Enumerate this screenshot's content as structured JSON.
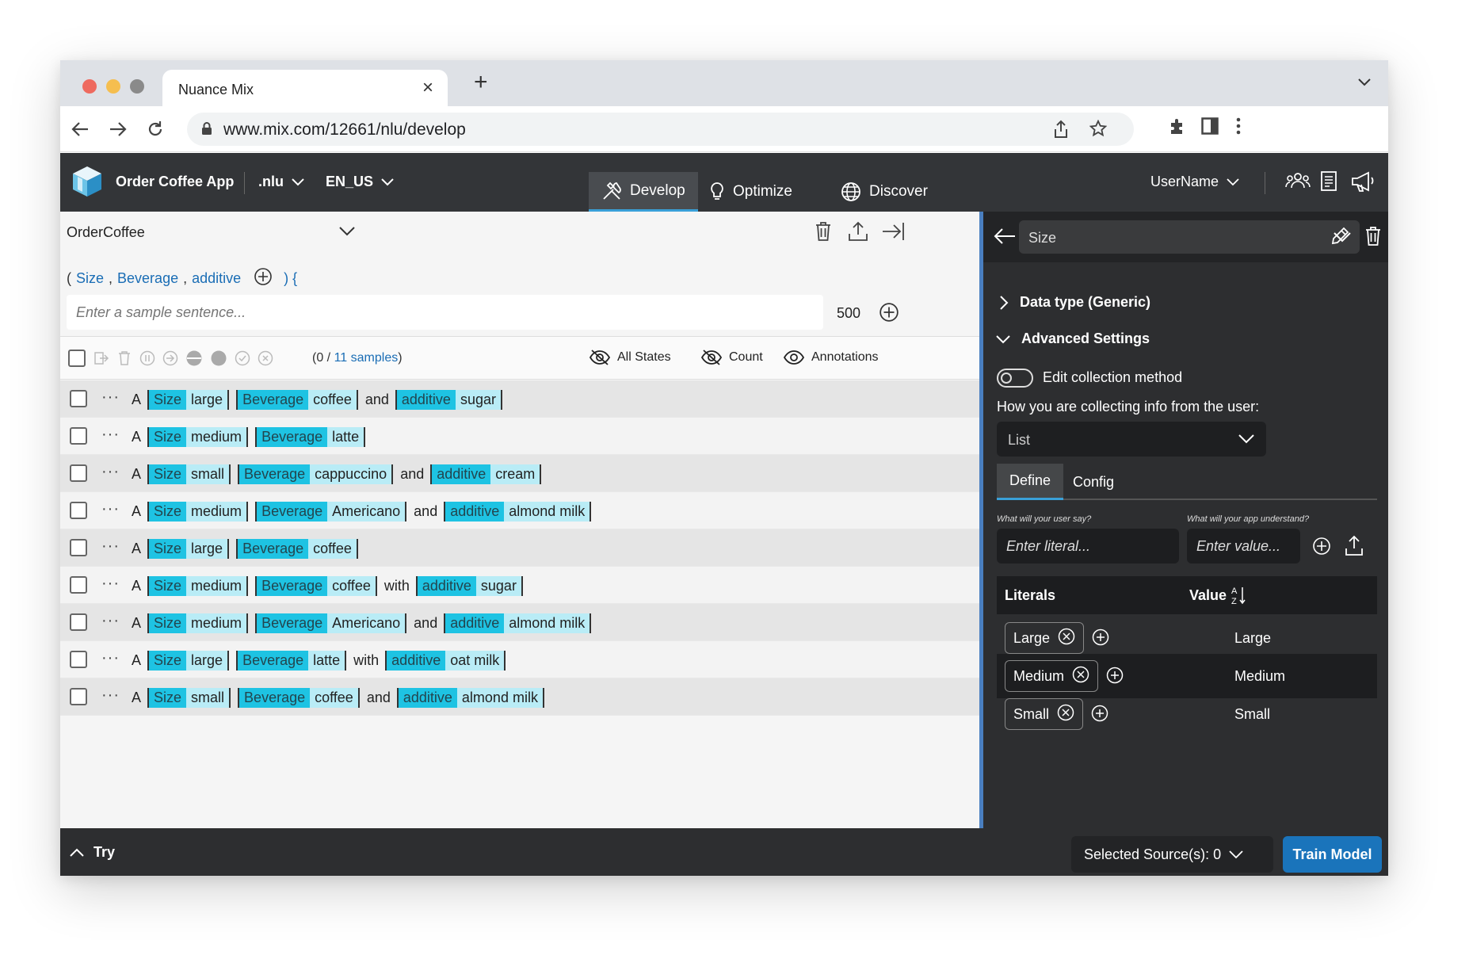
{
  "browser": {
    "tab_title": "Nuance Mix",
    "url": "www.mix.com/12661/nlu/develop"
  },
  "header": {
    "app_name": "Order Coffee App",
    "nlu_menu": ".nlu",
    "locale_menu": "EN_US",
    "tabs": [
      {
        "label": "Develop",
        "active": true
      },
      {
        "label": "Optimize",
        "active": false
      },
      {
        "label": "Discover",
        "active": false
      }
    ],
    "user_name": "UserName",
    "accent_color": "#3aa0d8"
  },
  "left": {
    "intent": "OrderCoffee",
    "pattern": {
      "open": "(",
      "entities": [
        "Size",
        "Beverage",
        "additive"
      ],
      "close": ") {"
    },
    "sample_placeholder": "Enter a sample sentence...",
    "sample_count": "500",
    "samples_count": {
      "prefix": "(0 /",
      "link": "11 samples",
      "suffix": ")"
    },
    "filters": [
      "All States",
      "Count",
      "Annotations"
    ],
    "annotation_colors": {
      "label_bg": "#1ec3e3",
      "value_bg": "#b9ecf6"
    },
    "samples": [
      [
        {
          "t": "w",
          "v": "A"
        },
        {
          "t": "a",
          "l": "Size",
          "v": "large"
        },
        {
          "t": "a",
          "l": "Beverage",
          "v": "coffee"
        },
        {
          "t": "w",
          "v": "and"
        },
        {
          "t": "a",
          "l": "additive",
          "v": "sugar"
        }
      ],
      [
        {
          "t": "w",
          "v": "A"
        },
        {
          "t": "a",
          "l": "Size",
          "v": "medium"
        },
        {
          "t": "a",
          "l": "Beverage",
          "v": "latte"
        }
      ],
      [
        {
          "t": "w",
          "v": "A"
        },
        {
          "t": "a",
          "l": "Size",
          "v": "small"
        },
        {
          "t": "a",
          "l": "Beverage",
          "v": "cappuccino"
        },
        {
          "t": "w",
          "v": "and"
        },
        {
          "t": "a",
          "l": "additive",
          "v": "cream"
        }
      ],
      [
        {
          "t": "w",
          "v": "A"
        },
        {
          "t": "a",
          "l": "Size",
          "v": "medium"
        },
        {
          "t": "a",
          "l": "Beverage",
          "v": "Americano"
        },
        {
          "t": "w",
          "v": "and"
        },
        {
          "t": "a",
          "l": "additive",
          "v": "almond milk"
        }
      ],
      [
        {
          "t": "w",
          "v": "A"
        },
        {
          "t": "a",
          "l": "Size",
          "v": "large"
        },
        {
          "t": "a",
          "l": "Beverage",
          "v": "coffee"
        }
      ],
      [
        {
          "t": "w",
          "v": "A"
        },
        {
          "t": "a",
          "l": "Size",
          "v": "medium"
        },
        {
          "t": "a",
          "l": "Beverage",
          "v": "coffee"
        },
        {
          "t": "w",
          "v": "with"
        },
        {
          "t": "a",
          "l": "additive",
          "v": "sugar"
        }
      ],
      [
        {
          "t": "w",
          "v": "A"
        },
        {
          "t": "a",
          "l": "Size",
          "v": "medium"
        },
        {
          "t": "a",
          "l": "Beverage",
          "v": "Americano"
        },
        {
          "t": "w",
          "v": "and"
        },
        {
          "t": "a",
          "l": "additive",
          "v": "almond milk"
        }
      ],
      [
        {
          "t": "w",
          "v": "A"
        },
        {
          "t": "a",
          "l": "Size",
          "v": "large"
        },
        {
          "t": "a",
          "l": "Beverage",
          "v": "latte"
        },
        {
          "t": "w",
          "v": "with"
        },
        {
          "t": "a",
          "l": "additive",
          "v": "oat milk"
        }
      ],
      [
        {
          "t": "w",
          "v": "A"
        },
        {
          "t": "a",
          "l": "Size",
          "v": "small"
        },
        {
          "t": "a",
          "l": "Beverage",
          "v": "coffee"
        },
        {
          "t": "w",
          "v": "and"
        },
        {
          "t": "a",
          "l": "additive",
          "v": "almond milk"
        }
      ]
    ]
  },
  "right": {
    "entity": "Size",
    "data_type": "Data type (Generic)",
    "advanced": "Advanced Settings",
    "edit_collection": "Edit collection method",
    "how_label": "How you are collecting info from the user:",
    "method": "List",
    "subtabs": [
      {
        "label": "Define",
        "active": true
      },
      {
        "label": "Config",
        "active": false
      }
    ],
    "hint_literal": "What will your user say?",
    "hint_value": "What will your app understand?",
    "literal_placeholder": "Enter literal...",
    "value_placeholder": "Enter value...",
    "col_literals": "Literals",
    "col_value": "Value",
    "literals": [
      {
        "literal": "Large",
        "value": "Large"
      },
      {
        "literal": "Medium",
        "value": "Medium",
        "selected": true
      },
      {
        "literal": "Small",
        "value": "Small"
      }
    ]
  },
  "bottom": {
    "try": "Try",
    "sources": "Selected Source(s): 0",
    "train": "Train Model"
  }
}
